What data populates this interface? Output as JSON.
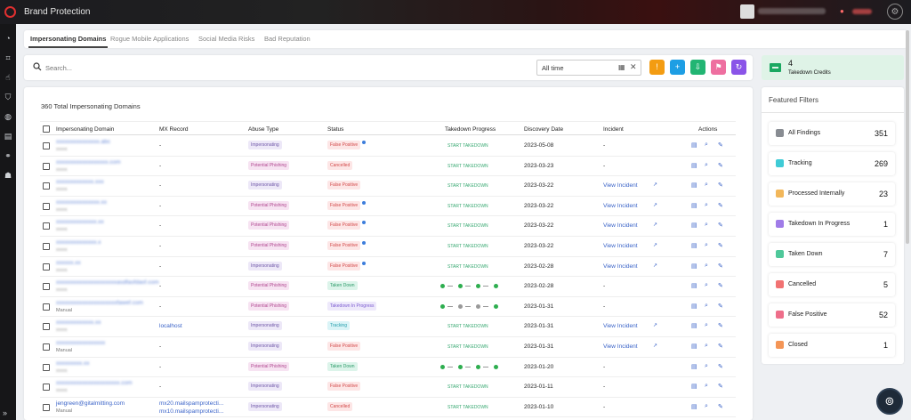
{
  "app": {
    "title": "Brand Protection"
  },
  "tabs": [
    "Impersonating Domains",
    "Rogue Mobile Applications",
    "Social Media Risks",
    "Bad Reputation"
  ],
  "search": {
    "placeholder": "Search...",
    "date_value": "All time"
  },
  "credits": {
    "count": "4",
    "label": "Takedown Credits"
  },
  "table": {
    "total_label": "360 Total Impersonating Domains",
    "headers": [
      "Impersonating Domain",
      "MX Record",
      "Abuse Type",
      "Status",
      "Takedown Progress",
      "Discovery Date",
      "Incident",
      "Actions"
    ],
    "rows": [
      {
        "domain": "xxxxxxxxxxxxxxx.abc",
        "sub": "xxxxx",
        "mx": "-",
        "abuse": "Impersonating",
        "status": "False Positive",
        "status_type": "fp",
        "dot": true,
        "progress": "START TAKEDOWN",
        "date": "2023-05-08",
        "incident": "-"
      },
      {
        "domain": "xxxxxxxxxxxxxxxxxx.com",
        "sub": "xxxxx",
        "mx": "-",
        "abuse": "Potential Phishing",
        "status": "Cancelled",
        "status_type": "can",
        "dot": false,
        "progress": "START TAKEDOWN",
        "date": "2023-03-23",
        "incident": "-"
      },
      {
        "domain": "xxxxxxxxxxxxx.xxx",
        "sub": "xxxxx",
        "mx": "-",
        "abuse": "Impersonating",
        "status": "False Positive",
        "status_type": "fp",
        "dot": false,
        "progress": "START TAKEDOWN",
        "date": "2023-03-22",
        "incident": "View Incident"
      },
      {
        "domain": "xxxxxxxxxxxxxxx.xx",
        "sub": "xxxxx",
        "mx": "-",
        "abuse": "Potential Phishing",
        "status": "False Positive",
        "status_type": "fp",
        "dot": true,
        "progress": "START TAKEDOWN",
        "date": "2023-03-22",
        "incident": "View Incident"
      },
      {
        "domain": "xxxxxxxxxxxxxx.xx",
        "sub": "xxxxx",
        "mx": "-",
        "abuse": "Potential Phishing",
        "status": "False Positive",
        "status_type": "fp",
        "dot": true,
        "progress": "START TAKEDOWN",
        "date": "2023-03-22",
        "incident": "View Incident"
      },
      {
        "domain": "xxxxxxxxxxxxxx.x",
        "sub": "xxxxx",
        "mx": "-",
        "abuse": "Potential Phishing",
        "status": "False Positive",
        "status_type": "fp",
        "dot": true,
        "progress": "START TAKEDOWN",
        "date": "2023-03-22",
        "incident": "View Incident"
      },
      {
        "domain": "xxxxxx.xx",
        "sub": "xxxxx",
        "mx": "-",
        "abuse": "Impersonating",
        "status": "False Positive",
        "status_type": "fp",
        "dot": true,
        "progress": "START TAKEDOWN",
        "date": "2023-02-28",
        "incident": "View Incident"
      },
      {
        "domain": "xxxxxxxxxxxxxxxxxxxxxasdfasfdasf.com",
        "sub": "xxxxx",
        "mx": "-",
        "abuse": "Potential Phishing",
        "status": "Taken Down",
        "status_type": "td",
        "dot": false,
        "progress": "dots-green",
        "date": "2023-02-28",
        "incident": "-"
      },
      {
        "domain": "xxxxxxxxxxxxxxxxxxxxxfawef.com",
        "sub": "Manual",
        "mx": "-",
        "abuse": "Potential Phishing",
        "status": "Takedown In Progress",
        "status_type": "tip",
        "dot": false,
        "progress": "dots-partial",
        "date": "2023-01-31",
        "incident": "-"
      },
      {
        "domain": "xxxxxxxxxxxxx.xx",
        "sub": "xxxxx",
        "mx": "localhost",
        "abuse": "Impersonating",
        "status": "Tracking",
        "status_type": "tr",
        "dot": false,
        "progress": "START TAKEDOWN",
        "date": "2023-01-31",
        "incident": "View Incident"
      },
      {
        "domain": "xxxxxxxxxxxxxxxxx",
        "sub": "Manual",
        "mx": "-",
        "abuse": "Impersonating",
        "status": "False Positive",
        "status_type": "fp",
        "dot": false,
        "progress": "START TAKEDOWN",
        "date": "2023-01-31",
        "incident": "View Incident"
      },
      {
        "domain": "xxxxxxxxx.xx",
        "sub": "xxxxx",
        "mx": "-",
        "abuse": "Potential Phishing",
        "status": "Taken Down",
        "status_type": "td",
        "dot": false,
        "progress": "dots-green",
        "date": "2023-01-20",
        "incident": "-"
      },
      {
        "domain": "xxxxxxxxxxxxxxxxxxxxxx.com",
        "sub": "xxxxx",
        "mx": "-",
        "abuse": "Impersonating",
        "status": "False Positive",
        "status_type": "fp",
        "dot": false,
        "progress": "START TAKEDOWN",
        "date": "2023-01-11",
        "incident": "-"
      },
      {
        "domain": "jengreen@gitalmitting.com",
        "sub": "Manual",
        "mx": "mx20.mailspamprotecti...",
        "mx2": "mx10.mailspamprotecti...",
        "abuse": "Impersonating",
        "status": "Cancelled",
        "status_type": "can",
        "dot": false,
        "progress": "START TAKEDOWN",
        "date": "2023-01-10",
        "incident": "-"
      }
    ]
  },
  "featured_filters": {
    "title": "Featured Filters",
    "items": [
      {
        "label": "All Findings",
        "count": "351",
        "color": "#888c92"
      },
      {
        "label": "Tracking",
        "count": "269",
        "color": "#3fcbd6"
      },
      {
        "label": "Processed Internally",
        "count": "23",
        "color": "#f2b75a"
      },
      {
        "label": "Takedown In Progress",
        "count": "1",
        "color": "#a07ce8"
      },
      {
        "label": "Taken Down",
        "count": "7",
        "color": "#4fc89a"
      },
      {
        "label": "Cancelled",
        "count": "5",
        "color": "#f17272"
      },
      {
        "label": "False Positive",
        "count": "52",
        "color": "#ee6e8a"
      },
      {
        "label": "Closed",
        "count": "1",
        "color": "#f49556"
      }
    ]
  },
  "action_buttons": [
    {
      "icon": "alert-icon",
      "color": "#f39c12"
    },
    {
      "icon": "plus-icon",
      "color": "#1e9ee4"
    },
    {
      "icon": "download-icon",
      "color": "#22b573"
    },
    {
      "icon": "flag-icon",
      "color": "#ee6fa0"
    },
    {
      "icon": "refresh-icon",
      "color": "#8a54e8"
    }
  ]
}
